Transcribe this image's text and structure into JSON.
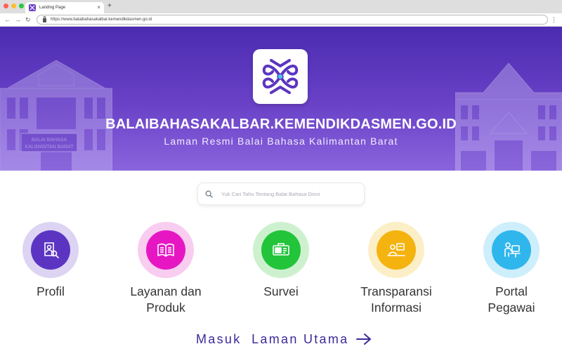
{
  "browser": {
    "tab_title": "Landing Page",
    "tab_close": "×",
    "new_tab": "+",
    "back": "←",
    "forward": "→",
    "reload": "↻",
    "url": "https://www.balaibahasakalbar.kemendikdasmen.go.id",
    "menu": "⋮"
  },
  "hero": {
    "title": "BALAIBAHASAKALBAR.KEMENDIKDASMEN.GO.ID",
    "subtitle": "Laman Resmi Balai Bahasa Kalimantan Barat",
    "building_sign": [
      "BALAI BAHASA",
      "KALIMANTAN BARAT"
    ]
  },
  "search": {
    "placeholder": "Yuk Cari Tahu Tentang Balai Bahasa Disni",
    "value": ""
  },
  "menu": [
    {
      "line1": "Profil",
      "line2": "",
      "icon": "profile-search-icon",
      "inner_color": "#5b35c2",
      "ring_color": "#ddd4f3"
    },
    {
      "line1": "Layanan dan",
      "line2": "Produk",
      "icon": "book-icon",
      "inner_color": "#e617c3",
      "ring_color": "#f8cdf0"
    },
    {
      "line1": "Survei",
      "line2": "",
      "icon": "survey-icon",
      "inner_color": "#22c43a",
      "ring_color": "#cdf1cf"
    },
    {
      "line1": "Transparansi",
      "line2": "Informasi",
      "icon": "transparency-icon",
      "inner_color": "#f5b310",
      "ring_color": "#fcefc7"
    },
    {
      "line1": "Portal",
      "line2": "Pegawai",
      "icon": "employee-portal-icon",
      "inner_color": "#2fb6ec",
      "ring_color": "#cdeefb"
    }
  ],
  "cta": {
    "label": "Masuk  Laman Utama"
  },
  "colors": {
    "brand": "#5b35c2",
    "cta": "#3b2a9a"
  }
}
